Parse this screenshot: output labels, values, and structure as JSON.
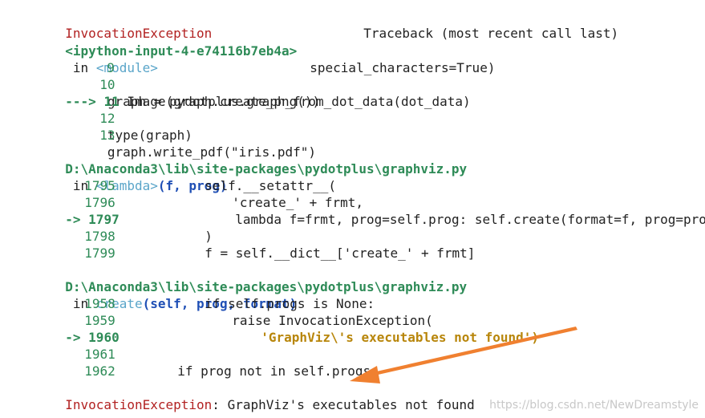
{
  "header": {
    "exception_name": "InvocationException",
    "traceback_title": "Traceback (most recent call last)"
  },
  "frame1": {
    "location": "<ipython-input-4-e74116b7eb4a>",
    "in": "in",
    "func": "<module>",
    "lines": [
      {
        "no": "9",
        "code": "special_characters=True)"
      },
      {
        "no": "10",
        "code": "graph = pydotplus.graph_from_dot_data(dot_data)"
      },
      {
        "no": "11",
        "marker": "--->",
        "code": "Image(graph.create_png())"
      },
      {
        "no": "12",
        "code": "type(graph)"
      },
      {
        "no": "13",
        "code": "graph.write_pdf(\"iris.pdf\")"
      }
    ]
  },
  "frame2": {
    "location": "D:\\Anaconda3\\lib\\site-packages\\pydotplus\\graphviz.py",
    "in": "in",
    "func": "<lambda>",
    "args": "(f, prog)",
    "lines": [
      {
        "no": "1795",
        "code": "self.__setattr__("
      },
      {
        "no": "1796",
        "code": "'create_' + frmt,"
      },
      {
        "no": "1797",
        "marker": "->",
        "code": "lambda f=frmt, prog=self.prog: self.create(format=f, prog=prog)"
      },
      {
        "no": "1798",
        "code": ")"
      },
      {
        "no": "1799",
        "code": "f = self.__dict__['create_' + frmt]"
      }
    ]
  },
  "frame3": {
    "location": "D:\\Anaconda3\\lib\\site-packages\\pydotplus\\graphviz.py",
    "in": "in",
    "func": "create",
    "args": "(self, prog, format)",
    "lines": [
      {
        "no": "1958",
        "code": "if self.progs is None:"
      },
      {
        "no": "1959",
        "code": "raise InvocationException("
      },
      {
        "no": "1960",
        "marker": "->",
        "code": "'GraphViz\\'s executables not found')"
      },
      {
        "no": "1961",
        "code": ""
      },
      {
        "no": "1962",
        "code": "if prog not in self.progs:"
      }
    ]
  },
  "final_error": {
    "name": "InvocationException",
    "message": ": GraphViz's executables not found"
  },
  "watermark": "https://blog.csdn.net/NewDreamstyle",
  "colors": {
    "exception_red": "#b22222",
    "green": "#2e8b57",
    "cyan": "#5aa5c9",
    "blue": "#1f4fb5",
    "annotation_orange": "#f08030"
  }
}
